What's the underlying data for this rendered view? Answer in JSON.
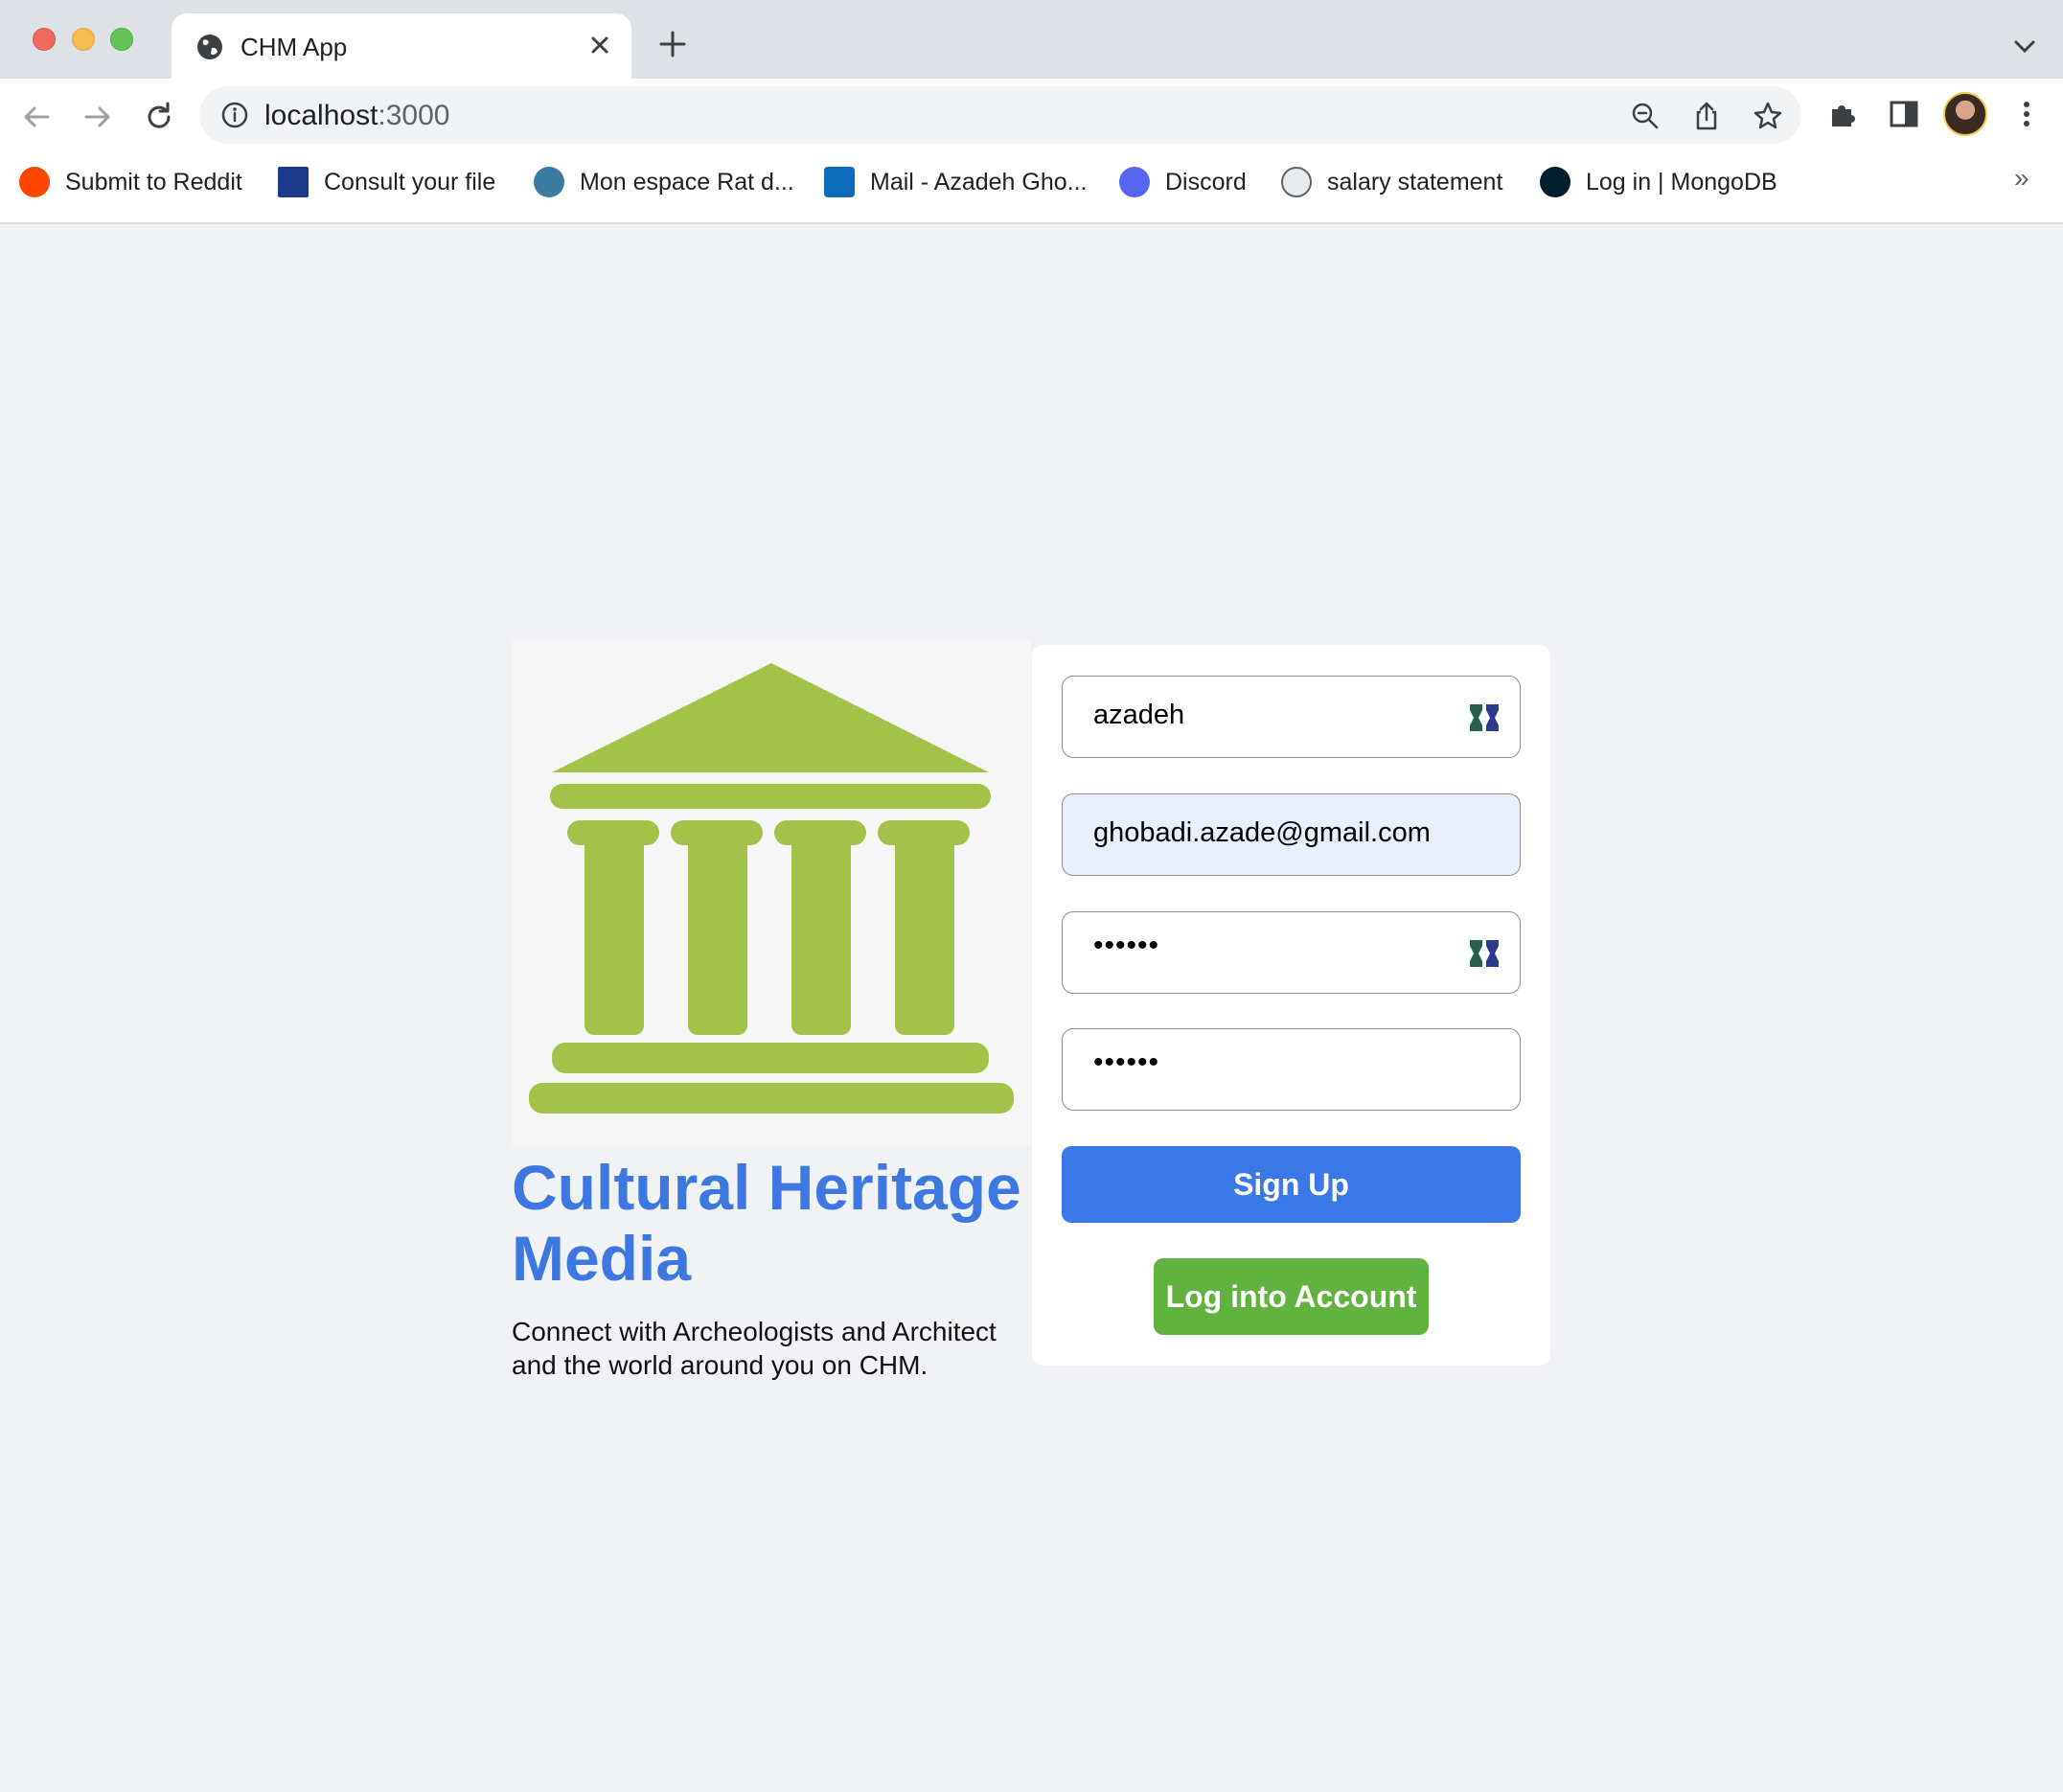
{
  "browser": {
    "tab": {
      "title": "CHM App"
    },
    "address_bar": {
      "host": "localhost",
      "port": ":3000"
    },
    "bookmarks": [
      {
        "label": "Submit to Reddit",
        "icon": "reddit-icon",
        "color": "#ff4500"
      },
      {
        "label": "Consult your file",
        "icon": "quebec-fleur-icon",
        "color": "#1d3a8a"
      },
      {
        "label": "Mon espace Rat d...",
        "icon": "p-circle-icon",
        "color": "#3b7ba0"
      },
      {
        "label": "Mail - Azadeh Gho...",
        "icon": "outlook-icon",
        "color": "#0f6cbd"
      },
      {
        "label": "Discord",
        "icon": "discord-icon",
        "color": "#5865f2"
      },
      {
        "label": "salary statement",
        "icon": "globe-icon",
        "color": "#5f6368"
      },
      {
        "label": "Log in | MongoDB",
        "icon": "mongodb-leaf-icon",
        "color": "#13aa52"
      }
    ],
    "more_bookmarks": "»"
  },
  "page": {
    "brand_title": "Cultural Heritage Media",
    "tagline": "Connect with Archeologists and Architect and the world around you on CHM.",
    "logo_icon": "classical-building-icon",
    "logo_color": "#a3c24a",
    "form": {
      "username_value": "azadeh",
      "email_value": "ghobadi.azade@gmail.com",
      "password_mask": "••••••",
      "confirm_password_mask": "••••••",
      "signup_label": "Sign Up",
      "login_label": "Log into Account"
    },
    "colors": {
      "primary": "#3b78e7",
      "success": "#62b23f",
      "title": "#3d77e0",
      "background": "#f0f2f5"
    }
  }
}
